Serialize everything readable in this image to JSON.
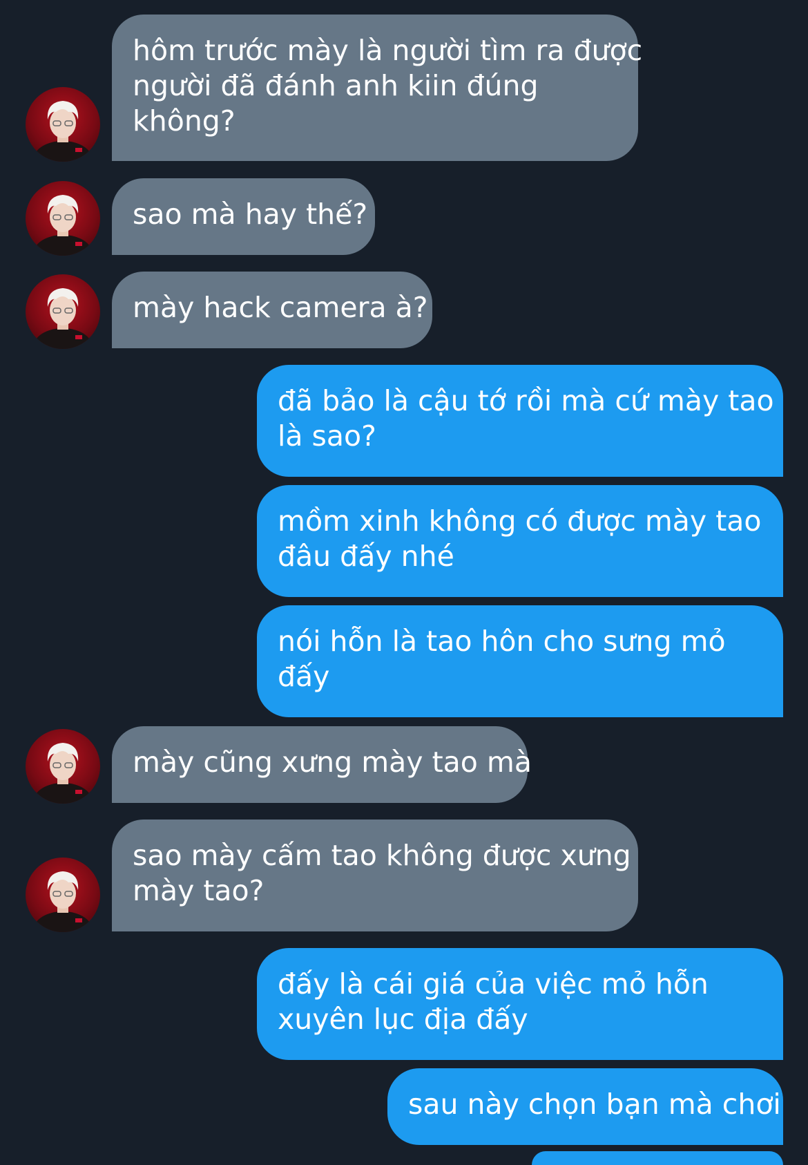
{
  "theme": {
    "background": "#171f2a",
    "incoming_bubble": "#667787",
    "outgoing_bubble": "#1d9bf0",
    "text_color": "#ffffff"
  },
  "contact": {
    "avatar_icon": "user-avatar-photo"
  },
  "messages": [
    {
      "sender": "contact",
      "lines": [
        "hôm trước mày là người tìm ra được",
        "người đã đánh anh kiin đúng",
        "không?"
      ]
    },
    {
      "sender": "contact",
      "lines": [
        "sao mà hay thế?"
      ]
    },
    {
      "sender": "contact",
      "lines": [
        "mày hack camera à?"
      ]
    },
    {
      "sender": "me",
      "lines": [
        "đã bảo là cậu tớ rồi mà cứ mày tao",
        "là sao?"
      ]
    },
    {
      "sender": "me",
      "lines": [
        "mồm xinh không có được mày tao",
        "đâu đấy nhé"
      ]
    },
    {
      "sender": "me",
      "lines": [
        "nói hỗn là tao hôn cho sưng mỏ",
        "đấy"
      ]
    },
    {
      "sender": "contact",
      "lines": [
        "mày cũng xưng mày tao mà"
      ]
    },
    {
      "sender": "contact",
      "lines": [
        "sao mày cấm tao không được xưng",
        "mày tao?"
      ]
    },
    {
      "sender": "me",
      "lines": [
        "đấy là cái giá của việc mỏ hỗn",
        "xuyên lục địa đấy"
      ]
    },
    {
      "sender": "me",
      "lines": [
        "sau này chọn bạn mà chơi"
      ]
    }
  ]
}
